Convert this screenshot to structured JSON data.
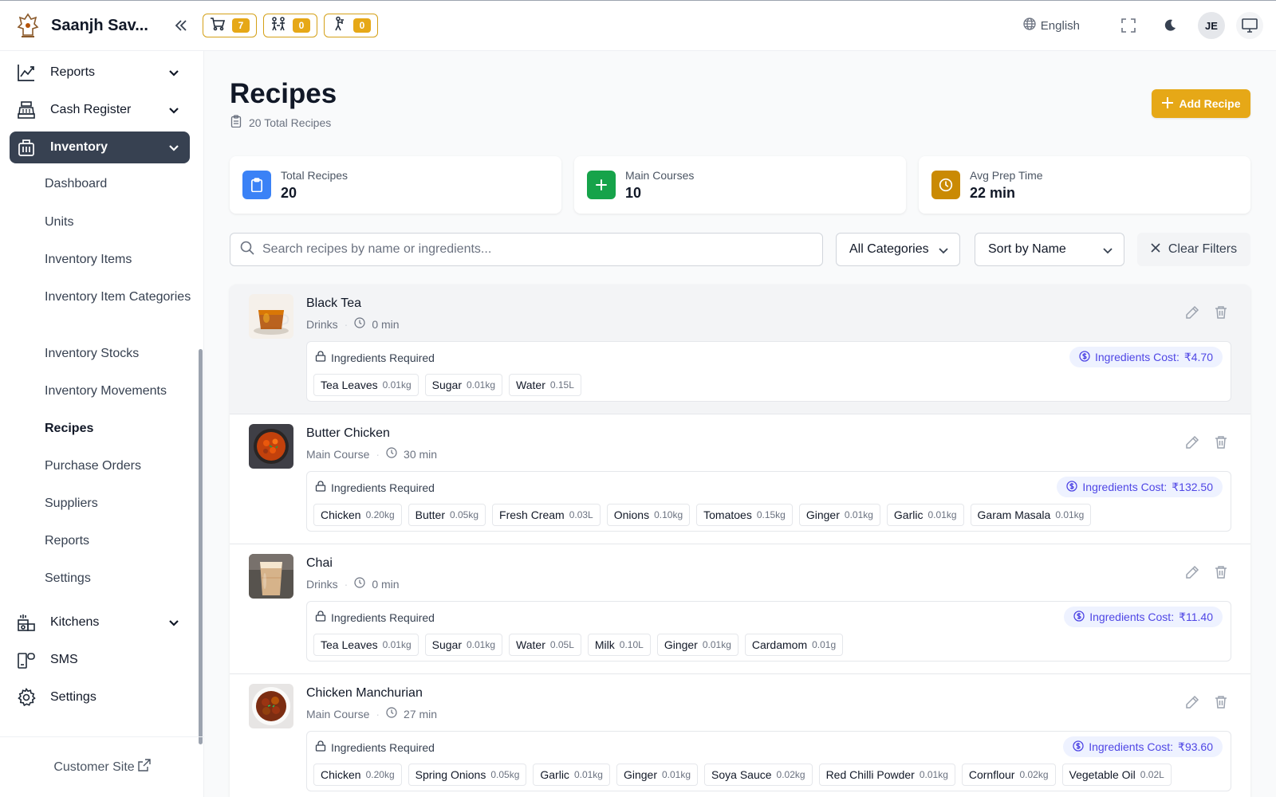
{
  "app": {
    "brand": "Saanjh Sav...",
    "counters": [
      {
        "icon": "cart-icon",
        "value": "7"
      },
      {
        "icon": "dine-in-icon",
        "value": "0"
      },
      {
        "icon": "waiter-icon",
        "value": "0"
      }
    ],
    "language": "English",
    "user_initials": "JE"
  },
  "sidebar": {
    "items": [
      {
        "label": "Reports",
        "icon": "chart-line-icon"
      },
      {
        "label": "Cash Register",
        "icon": "cash-register-icon"
      },
      {
        "label": "Inventory",
        "icon": "inventory-basket-icon"
      },
      {
        "label": "Kitchens",
        "icon": "kitchen-icon"
      },
      {
        "label": "SMS",
        "icon": "sms-icon"
      },
      {
        "label": "Settings",
        "icon": "gear-icon"
      }
    ],
    "inventory_sub": [
      "Dashboard",
      "Units",
      "Inventory Items",
      "Inventory Item Categories",
      "Inventory Stocks",
      "Inventory Movements",
      "Recipes",
      "Purchase Orders",
      "Suppliers",
      "Reports",
      "Settings"
    ],
    "customer_site": "Customer Site"
  },
  "page": {
    "title": "Recipes",
    "total_label": "20 Total Recipes",
    "add_button": "Add Recipe"
  },
  "stats": [
    {
      "label": "Total Recipes",
      "value": "20",
      "color": "#3b82f6"
    },
    {
      "label": "Main Courses",
      "value": "10",
      "color": "#16a34a"
    },
    {
      "label": "Avg Prep Time",
      "value": "22 min",
      "color": "#ca8a04"
    }
  ],
  "filters": {
    "search_placeholder": "Search recipes by name or ingredients...",
    "category": "All Categories",
    "sort": "Sort by Name",
    "clear": "Clear Filters"
  },
  "ingredients_label": "Ingredients Required",
  "cost_label": "Ingredients Cost:",
  "recipes": [
    {
      "name": "Black Tea",
      "category": "Drinks",
      "time": "0 min",
      "cost": "₹4.70",
      "ingredients": [
        {
          "name": "Tea Leaves",
          "qty": "0.01kg"
        },
        {
          "name": "Sugar",
          "qty": "0.01kg"
        },
        {
          "name": "Water",
          "qty": "0.15L"
        }
      ]
    },
    {
      "name": "Butter Chicken",
      "category": "Main Course",
      "time": "30 min",
      "cost": "₹132.50",
      "ingredients": [
        {
          "name": "Chicken",
          "qty": "0.20kg"
        },
        {
          "name": "Butter",
          "qty": "0.05kg"
        },
        {
          "name": "Fresh Cream",
          "qty": "0.03L"
        },
        {
          "name": "Onions",
          "qty": "0.10kg"
        },
        {
          "name": "Tomatoes",
          "qty": "0.15kg"
        },
        {
          "name": "Ginger",
          "qty": "0.01kg"
        },
        {
          "name": "Garlic",
          "qty": "0.01kg"
        },
        {
          "name": "Garam Masala",
          "qty": "0.01kg"
        }
      ]
    },
    {
      "name": "Chai",
      "category": "Drinks",
      "time": "0 min",
      "cost": "₹11.40",
      "ingredients": [
        {
          "name": "Tea Leaves",
          "qty": "0.01kg"
        },
        {
          "name": "Sugar",
          "qty": "0.01kg"
        },
        {
          "name": "Water",
          "qty": "0.05L"
        },
        {
          "name": "Milk",
          "qty": "0.10L"
        },
        {
          "name": "Ginger",
          "qty": "0.01kg"
        },
        {
          "name": "Cardamom",
          "qty": "0.01g"
        }
      ]
    },
    {
      "name": "Chicken Manchurian",
      "category": "Main Course",
      "time": "27 min",
      "cost": "₹93.60",
      "ingredients": [
        {
          "name": "Chicken",
          "qty": "0.20kg"
        },
        {
          "name": "Spring Onions",
          "qty": "0.05kg"
        },
        {
          "name": "Garlic",
          "qty": "0.01kg"
        },
        {
          "name": "Ginger",
          "qty": "0.01kg"
        },
        {
          "name": "Soya Sauce",
          "qty": "0.02kg"
        },
        {
          "name": "Red Chilli Powder",
          "qty": "0.01kg"
        },
        {
          "name": "Cornflour",
          "qty": "0.02kg"
        },
        {
          "name": "Vegetable Oil",
          "qty": "0.02L"
        }
      ]
    }
  ]
}
